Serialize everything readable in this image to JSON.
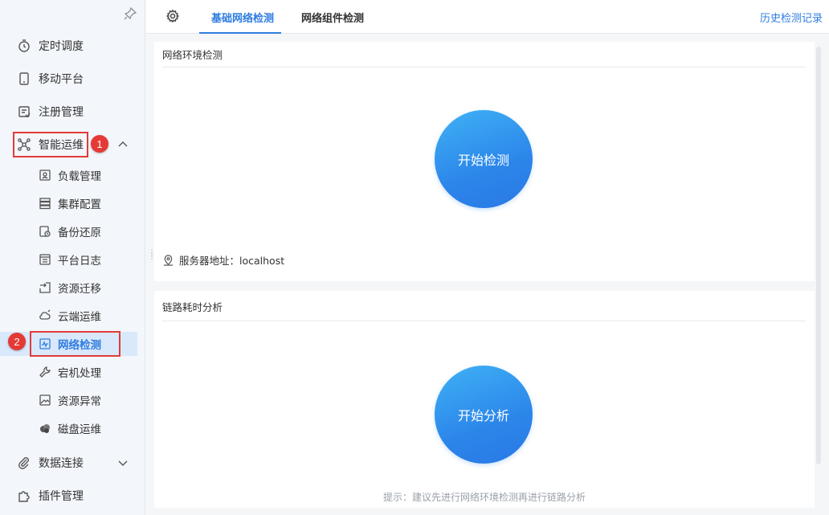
{
  "sidebar": {
    "items": [
      {
        "label": "定时调度",
        "icon": "timer-icon"
      },
      {
        "label": "移动平台",
        "icon": "mobile-icon"
      },
      {
        "label": "注册管理",
        "icon": "register-icon"
      },
      {
        "label": "智能运维",
        "icon": "ops-icon"
      },
      {
        "label": "数据连接",
        "icon": "paperclip-icon"
      },
      {
        "label": "插件管理",
        "icon": "puzzle-icon"
      }
    ],
    "subitems": [
      {
        "label": "负载管理",
        "icon": "load-icon"
      },
      {
        "label": "集群配置",
        "icon": "cluster-icon"
      },
      {
        "label": "备份还原",
        "icon": "backup-icon"
      },
      {
        "label": "平台日志",
        "icon": "log-icon"
      },
      {
        "label": "资源迁移",
        "icon": "migrate-icon"
      },
      {
        "label": "云端运维",
        "icon": "cloud-icon"
      },
      {
        "label": "网络检测",
        "icon": "network-icon"
      },
      {
        "label": "宕机处理",
        "icon": "wrench-icon"
      },
      {
        "label": "资源异常",
        "icon": "image-icon"
      },
      {
        "label": "磁盘运维",
        "icon": "disk-icon"
      }
    ]
  },
  "badges": {
    "one": "1",
    "two": "2"
  },
  "topbar": {
    "tabs": [
      {
        "label": "基础网络检测",
        "active": true
      },
      {
        "label": "网络组件检测",
        "active": false
      }
    ],
    "history_link": "历史检测记录"
  },
  "panel_env": {
    "title": "网络环境检测",
    "button": "开始检测",
    "server_label": "服务器地址：localhost"
  },
  "panel_link": {
    "title": "链路耗时分析",
    "button": "开始分析",
    "hint": "提示：建议先进行网络环境检测再进行链路分析"
  },
  "colors": {
    "accent": "#2f7ce0",
    "annotation_red": "#e53935"
  }
}
